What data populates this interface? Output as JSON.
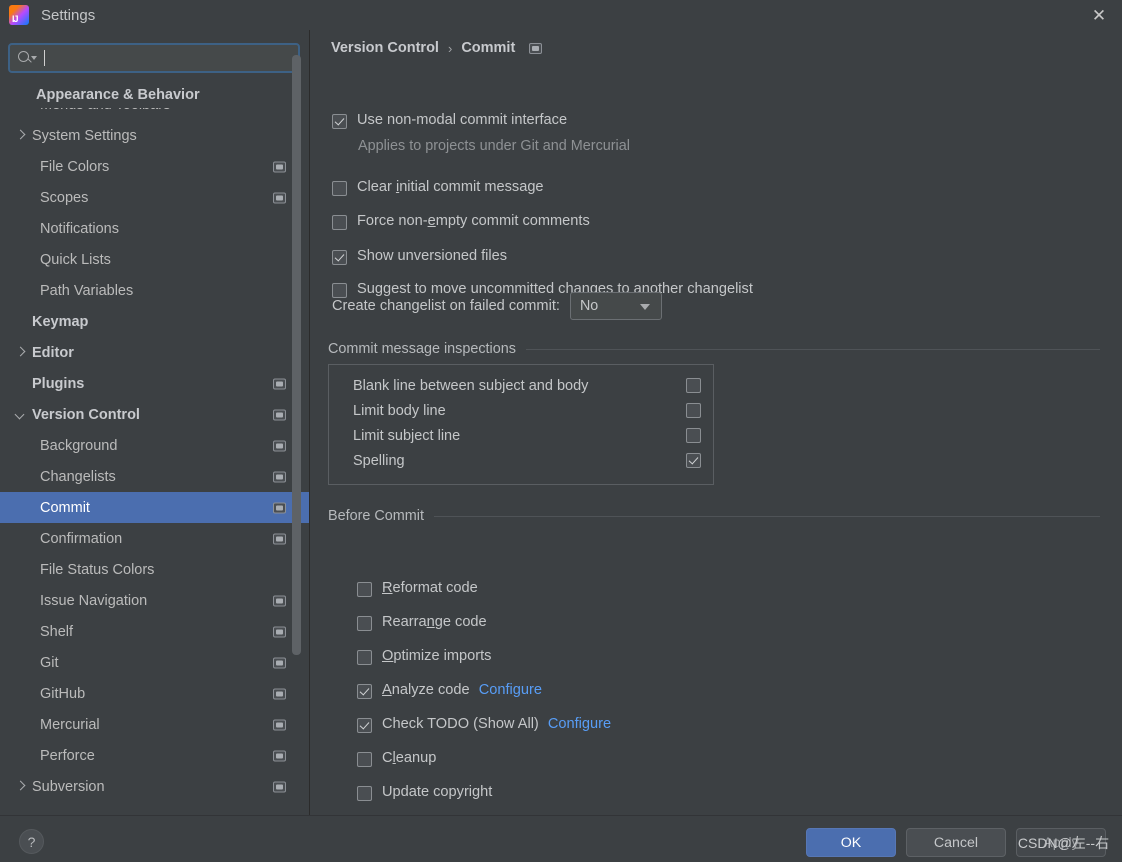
{
  "window": {
    "title": "Settings",
    "logo_icon": "intellij-idea-logo",
    "close_icon": "close-icon"
  },
  "search": {
    "value": "",
    "placeholder": "",
    "icon": "search-icon",
    "dropdown_icon": "chevron-down-icon"
  },
  "sidebar": {
    "sticky_header": "Appearance & Behavior",
    "scrollbar": "vertical-scrollbar",
    "items": [
      {
        "label": "Appearance & Behavior",
        "level": 0,
        "bold": true,
        "twisty": "down",
        "badge": false,
        "selected": false
      },
      {
        "label": "Menus and Toolbars",
        "level": 1,
        "bold": false,
        "twisty": "none",
        "badge": false,
        "selected": false
      },
      {
        "label": "System Settings",
        "level": 1,
        "bold": false,
        "twisty": "right",
        "badge": false,
        "selected": false
      },
      {
        "label": "File Colors",
        "level": 1,
        "bold": false,
        "twisty": "none",
        "badge": true,
        "selected": false
      },
      {
        "label": "Scopes",
        "level": 1,
        "bold": false,
        "twisty": "none",
        "badge": true,
        "selected": false
      },
      {
        "label": "Notifications",
        "level": 1,
        "bold": false,
        "twisty": "none",
        "badge": false,
        "selected": false
      },
      {
        "label": "Quick Lists",
        "level": 1,
        "bold": false,
        "twisty": "none",
        "badge": false,
        "selected": false
      },
      {
        "label": "Path Variables",
        "level": 1,
        "bold": false,
        "twisty": "none",
        "badge": false,
        "selected": false
      },
      {
        "label": "Keymap",
        "level": 0,
        "bold": true,
        "twisty": "none",
        "badge": false,
        "selected": false
      },
      {
        "label": "Editor",
        "level": 0,
        "bold": true,
        "twisty": "right",
        "badge": false,
        "selected": false
      },
      {
        "label": "Plugins",
        "level": 0,
        "bold": true,
        "twisty": "none",
        "badge": true,
        "selected": false
      },
      {
        "label": "Version Control",
        "level": 0,
        "bold": true,
        "twisty": "down",
        "badge": true,
        "selected": false
      },
      {
        "label": "Background",
        "level": 1,
        "bold": false,
        "twisty": "none",
        "badge": true,
        "selected": false
      },
      {
        "label": "Changelists",
        "level": 1,
        "bold": false,
        "twisty": "none",
        "badge": true,
        "selected": false
      },
      {
        "label": "Commit",
        "level": 1,
        "bold": false,
        "twisty": "none",
        "badge": true,
        "selected": true
      },
      {
        "label": "Confirmation",
        "level": 1,
        "bold": false,
        "twisty": "none",
        "badge": true,
        "selected": false
      },
      {
        "label": "File Status Colors",
        "level": 1,
        "bold": false,
        "twisty": "none",
        "badge": false,
        "selected": false
      },
      {
        "label": "Issue Navigation",
        "level": 1,
        "bold": false,
        "twisty": "none",
        "badge": true,
        "selected": false
      },
      {
        "label": "Shelf",
        "level": 1,
        "bold": false,
        "twisty": "none",
        "badge": true,
        "selected": false
      },
      {
        "label": "Git",
        "level": 1,
        "bold": false,
        "twisty": "none",
        "badge": true,
        "selected": false
      },
      {
        "label": "GitHub",
        "level": 1,
        "bold": false,
        "twisty": "none",
        "badge": true,
        "selected": false
      },
      {
        "label": "Mercurial",
        "level": 1,
        "bold": false,
        "twisty": "none",
        "badge": true,
        "selected": false
      },
      {
        "label": "Perforce",
        "level": 1,
        "bold": false,
        "twisty": "none",
        "badge": true,
        "selected": false
      },
      {
        "label": "Subversion",
        "level": 1,
        "bold": false,
        "twisty": "right",
        "badge": true,
        "selected": false
      }
    ]
  },
  "content": {
    "breadcrumb": {
      "root": "Version Control",
      "separator": "›",
      "current": "Commit",
      "badge_icon": "project-scope-icon"
    },
    "options": [
      {
        "label_pre": "Use non-modal commit interface",
        "mnemonic": "",
        "label_post": "",
        "checked": true,
        "note": "Applies to projects under Git and Mercurial"
      },
      {
        "label_pre": "Clear ",
        "mnemonic": "i",
        "label_post": "nitial commit message",
        "checked": false,
        "note": ""
      },
      {
        "label_pre": "Force non-",
        "mnemonic": "e",
        "label_post": "mpty commit comments",
        "checked": false,
        "note": ""
      },
      {
        "label_pre": "Show unversioned files",
        "mnemonic": "",
        "label_post": "",
        "checked": true,
        "note": ""
      },
      {
        "label_pre": "Suggest to move uncommitted changes ",
        "mnemonic": "t",
        "label_post": "o another changelist",
        "checked": false,
        "note": ""
      }
    ],
    "changelist_row": {
      "label": "Create changelist on failed commit:",
      "value": "No",
      "options": [
        "No"
      ]
    },
    "inspections": {
      "title": "Commit message inspections",
      "rows": [
        {
          "label": "Blank line between subject and body",
          "checked": false
        },
        {
          "label": "Limit body line",
          "checked": false
        },
        {
          "label": "Limit subject line",
          "checked": false
        },
        {
          "label": "Spelling",
          "checked": true
        }
      ]
    },
    "before_commit": {
      "title": "Before Commit",
      "rows": [
        {
          "pre": "",
          "mnemonic": "R",
          "post": "eformat code",
          "checked": false,
          "link": ""
        },
        {
          "pre": "Rearra",
          "mnemonic": "n",
          "post": "ge code",
          "checked": false,
          "link": ""
        },
        {
          "pre": "",
          "mnemonic": "O",
          "post": "ptimize imports",
          "checked": false,
          "link": ""
        },
        {
          "pre": "",
          "mnemonic": "A",
          "post": "nalyze code ",
          "checked": true,
          "link": "Configure"
        },
        {
          "pre": "Check TODO (Show All) ",
          "mnemonic": "",
          "post": "",
          "checked": true,
          "link": "Configure"
        },
        {
          "pre": "C",
          "mnemonic": "l",
          "post": "eanup",
          "checked": false,
          "link": ""
        },
        {
          "pre": "Update copyright",
          "mnemonic": "",
          "post": "",
          "checked": false,
          "link": ""
        }
      ]
    }
  },
  "footer": {
    "help_icon": "help-icon",
    "ok_label": "OK",
    "cancel_label": "Cancel",
    "apply_label": "Apply",
    "watermark": "CSDN@左--右"
  },
  "colors": {
    "background": "#3c4043",
    "selection": "#4b6eaf",
    "link": "#589df6",
    "text": "#c5c7c9",
    "muted": "#8e9194"
  }
}
